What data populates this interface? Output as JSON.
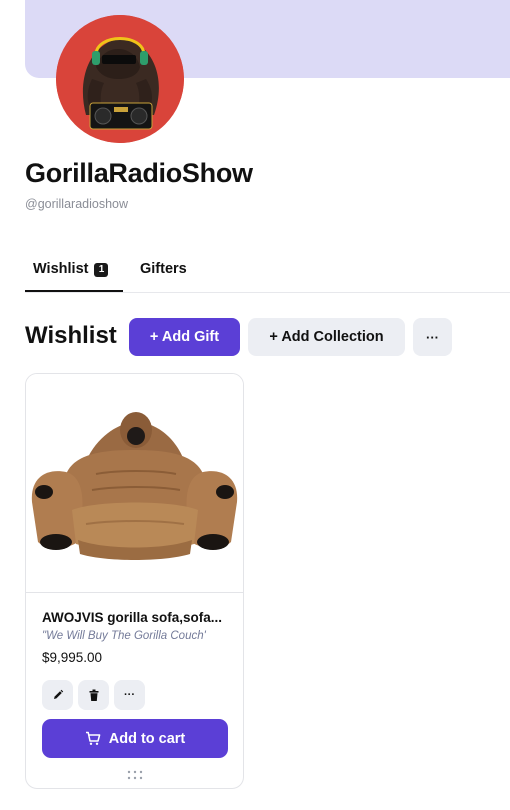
{
  "profile": {
    "name": "GorillaRadioShow",
    "handle": "@gorillaradioshow",
    "avatar_colors": {
      "background": "#d9443a",
      "gorilla": "#3b2a22",
      "headphones": "#f0c419"
    }
  },
  "tabs": [
    {
      "label": "Wishlist",
      "count": "1",
      "active": true
    },
    {
      "label": "Gifters",
      "active": false
    }
  ],
  "section": {
    "title": "Wishlist",
    "add_gift_label": "+ Add Gift",
    "add_collection_label": "+ Add Collection",
    "more_label": "···"
  },
  "items": [
    {
      "title": "AWOJVIS gorilla sofa,sofa...",
      "note": "\"We Will Buy The Gorilla Couch'",
      "price": "$9,995.00",
      "cart_label": "Add to cart",
      "more_label": "···"
    }
  ],
  "colors": {
    "accent": "#5b3fd6",
    "banner": "#dcdaf6",
    "secondary_button": "#eceef3"
  }
}
